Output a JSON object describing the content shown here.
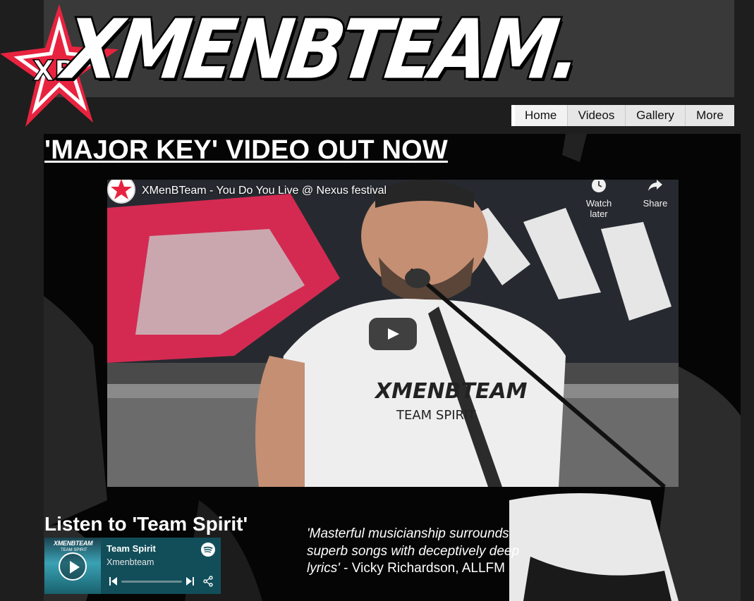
{
  "brand": {
    "logo_text": "XMENBTEAM.",
    "accent_color": "#e8233f"
  },
  "nav": {
    "items": [
      {
        "label": "Home",
        "active": true
      },
      {
        "label": "Videos",
        "active": false
      },
      {
        "label": "Gallery",
        "active": false
      },
      {
        "label": "More",
        "active": false
      }
    ]
  },
  "headline": "'MAJOR KEY' VIDEO OUT NOW",
  "video": {
    "title": "XMenBTeam - You Do You Live @ Nexus festival",
    "watch_later": "Watch later",
    "share": "Share",
    "icons": [
      "clock-icon",
      "share-arrow-icon",
      "play-icon"
    ]
  },
  "listen": {
    "heading": "Listen to 'Team Spirit'",
    "player": {
      "track": "Team Spirit",
      "artist": "Xmenbteam",
      "progress": 0.0,
      "cover_title": "XMENBTEAM",
      "cover_subtitle": "TEAM SPIRIT"
    }
  },
  "quote": {
    "text": "'Masterful musicianship surrounds superb songs with deceptively deep lyrics'",
    "attribution": " - Vicky Richardson, ALLFM"
  }
}
